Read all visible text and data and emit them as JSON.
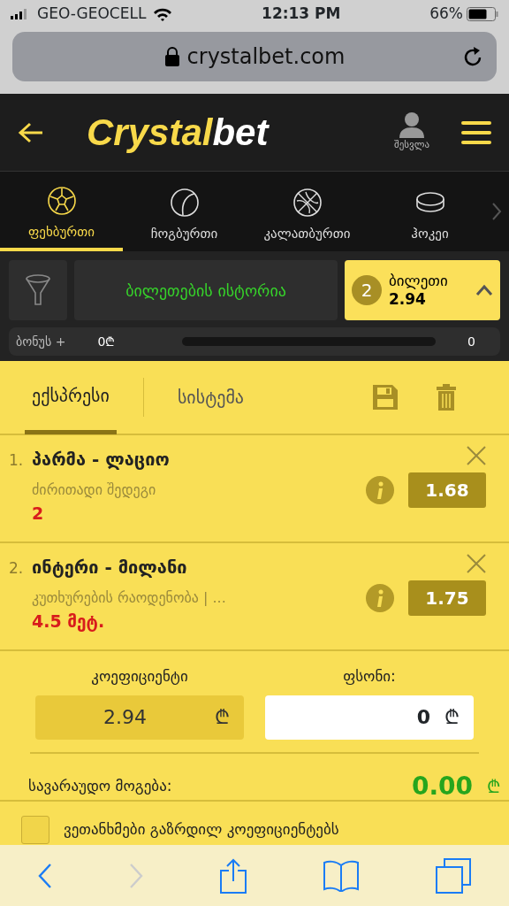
{
  "status_bar": {
    "carrier": "GEO-GEOCELL",
    "time": "12:13 PM",
    "battery": "66%"
  },
  "address_bar": {
    "url": "crystalbet.com"
  },
  "header": {
    "logo_main": "Crystal",
    "logo_accent": "bet",
    "login": "შესვლა"
  },
  "sports": [
    {
      "label": "ფეხბურთი",
      "selected": true,
      "kind": "football"
    },
    {
      "label": "ჩოგბურთი",
      "selected": false,
      "kind": "tennis"
    },
    {
      "label": "კალათბურთი",
      "selected": false,
      "kind": "basketball"
    },
    {
      "label": "ჰოკეი",
      "selected": false,
      "kind": "hockey"
    }
  ],
  "history_button": "ბილეთების ისტორია",
  "ticket": {
    "count": "2",
    "label": "ბილეთი",
    "odds": "2.94",
    "expanded": true
  },
  "bonus": {
    "label": "ბონუს +",
    "start": "0₾",
    "end": "0",
    "level": 0
  },
  "slip_tabs": [
    {
      "label": "ექსპრესი",
      "selected": true
    },
    {
      "label": "სისტემა",
      "selected": false
    }
  ],
  "bets": [
    {
      "number": "1.",
      "match": "პარმა - ლაციო",
      "market": "ძირითადი შედეგი",
      "pick": "2",
      "odds": "1.68"
    },
    {
      "number": "2.",
      "match": "ინტერი - მილანი",
      "market": "კუთხურების რაოდენობა | ...",
      "pick": "4.5 მეტ.",
      "odds": "1.75"
    }
  ],
  "coefficient": {
    "label": "კოეფიციენტი",
    "value": "2.94",
    "currency": "₾"
  },
  "stake": {
    "label": "ფსონი:",
    "value": "0",
    "currency": "₾"
  },
  "winnings": {
    "label": "სავარაუდო მოგება:",
    "value": "0.00",
    "currency": "₾"
  },
  "agree": {
    "label": "ვეთანხმები გაზრდილ კოეფიციენტებს",
    "checked": false
  }
}
